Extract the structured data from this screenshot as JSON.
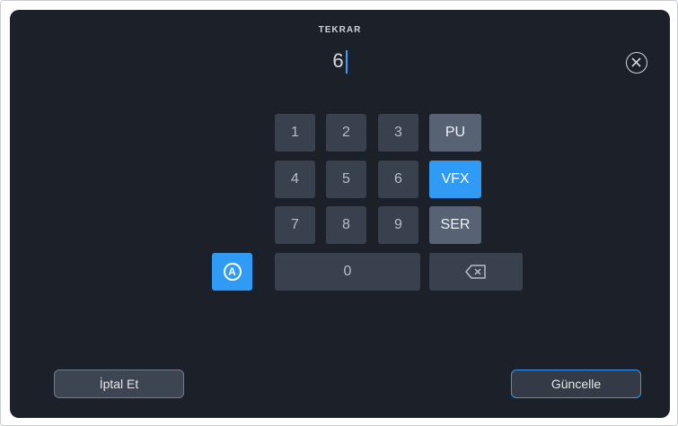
{
  "header": {
    "title": "TEKRAR",
    "value": "6"
  },
  "keypad": {
    "digits": [
      "1",
      "2",
      "3",
      "4",
      "5",
      "6",
      "7",
      "8",
      "9",
      "0"
    ],
    "options": [
      {
        "label": "PU",
        "active": false
      },
      {
        "label": "VFX",
        "active": true
      },
      {
        "label": "SER",
        "active": false
      }
    ],
    "auto_label": "A"
  },
  "footer": {
    "cancel_label": "İptal Et",
    "update_label": "Güncelle"
  },
  "colors": {
    "accent": "#2f9bf4",
    "background": "#1c2028",
    "key": "#3a414e"
  },
  "icons": {
    "close": "close-circle-icon",
    "auto": "auto-circle-icon",
    "backspace": "backspace-icon"
  }
}
